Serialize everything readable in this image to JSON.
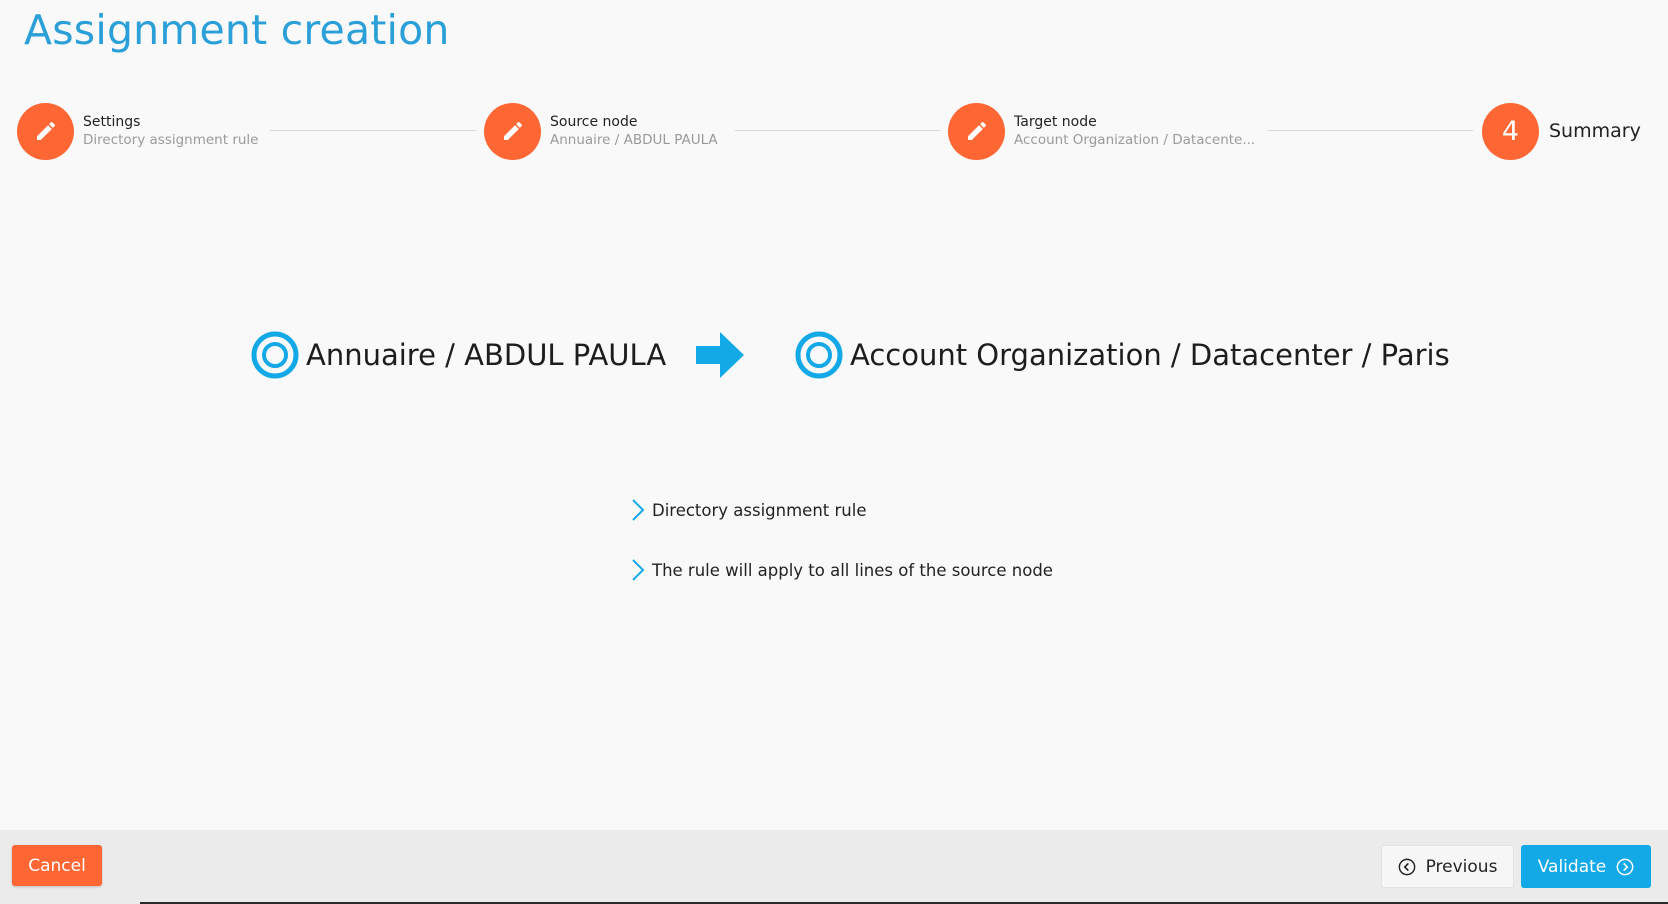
{
  "page": {
    "title": "Assignment creation"
  },
  "stepper": {
    "steps": [
      {
        "label": "Settings",
        "sublabel": "Directory assignment rule",
        "icon": "pencil-icon",
        "state": "done"
      },
      {
        "label": "Source node",
        "sublabel": "Annuaire / ABDUL PAULA",
        "icon": "pencil-icon",
        "state": "done"
      },
      {
        "label": "Target node",
        "sublabel": "Account Organization / Datacente...",
        "icon": "pencil-icon",
        "state": "done"
      },
      {
        "label": "Summary",
        "number": "4",
        "state": "current"
      }
    ]
  },
  "summary": {
    "source": "Annuaire / ABDUL PAULA",
    "target": "Account Organization / Datacenter / Paris",
    "details": [
      "Directory assignment rule",
      "The rule will apply to all lines of the source node"
    ]
  },
  "footer": {
    "cancel_label": "Cancel",
    "previous_label": "Previous",
    "validate_label": "Validate"
  },
  "colors": {
    "accent_orange": "#fe6633",
    "accent_blue": "#13a9e7",
    "title_blue": "#2b9fd8"
  }
}
